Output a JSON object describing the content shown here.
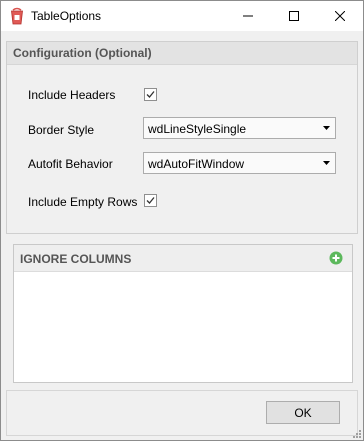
{
  "window": {
    "title": "TableOptions",
    "icon": "app-bucket-icon",
    "controls": [
      "minimize-icon",
      "maximize-icon",
      "close-icon"
    ]
  },
  "configuration": {
    "title": "Configuration (Optional)",
    "include_headers": {
      "label": "Include Headers",
      "checked": true
    },
    "border_style": {
      "label": "Border Style",
      "value": "wdLineStyleSingle"
    },
    "autofit_behavior": {
      "label": "Autofit Behavior",
      "value": "wdAutoFitWindow"
    },
    "include_empty_rows": {
      "label": "Include Empty Rows",
      "checked": true
    }
  },
  "ignore_columns": {
    "title": "IGNORE COLUMNS",
    "add_icon": "add-circle-icon",
    "items": []
  },
  "footer": {
    "ok_label": "OK"
  },
  "colors": {
    "add_icon_green": "#5cb85c",
    "app_icon_red": "#d9534f"
  }
}
